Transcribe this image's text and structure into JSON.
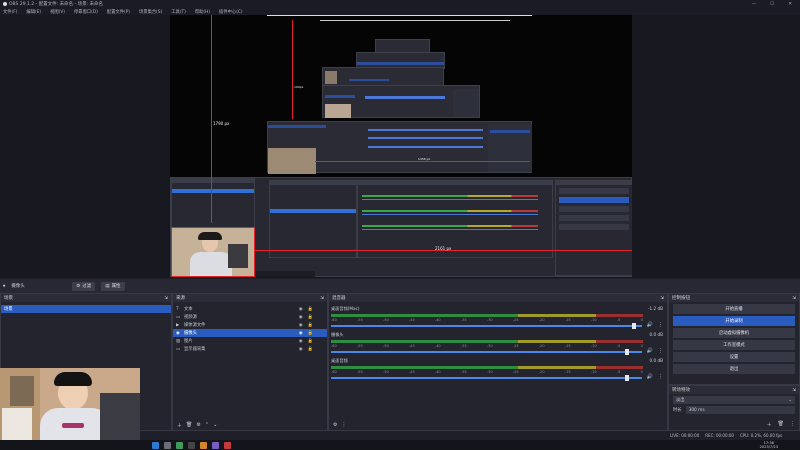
{
  "window": {
    "title": "OBS 29.1.2 - 配置文件: 未命名 - 场景: 未命名",
    "controls": [
      "—",
      "☐",
      "✕"
    ]
  },
  "menu": [
    "文件(F)",
    "编辑(E)",
    "视图(V)",
    "停靠窗口(D)",
    "配置文件(P)",
    "场景集合(S)",
    "工具(T)",
    "帮助(H)",
    "插件中心(C)"
  ],
  "preview": {
    "height_label": "1790 px",
    "width_label": "2161 px",
    "nested_h_label": "199px",
    "nested_w_label": "1456 px"
  },
  "scenebar": {
    "scene_name": "摄像头",
    "filter_btn": "过滤",
    "properties_btn": "属性"
  },
  "scenes": {
    "title": "场景",
    "items": [
      "场景"
    ],
    "selected": 0
  },
  "sources": {
    "title": "来源",
    "items": [
      "文本",
      "视频源",
      "媒体源文件",
      "摄像头",
      "图片",
      "显示器采集"
    ],
    "selected": 3
  },
  "mixer": {
    "title": "混音器",
    "channels": [
      {
        "name": "桌面音频(Mac)",
        "db": "-1.2 dB",
        "level": 0.98
      },
      {
        "name": "摄像头",
        "db": "0.0 dB",
        "level": 0.96
      },
      {
        "name": "桌面音频",
        "db": "0.0 dB",
        "level": 0.96
      }
    ],
    "ticks": [
      "-60",
      "-55",
      "-50",
      "-45",
      "-40",
      "-35",
      "-30",
      "-25",
      "-20",
      "-15",
      "-10",
      "-5",
      "0"
    ]
  },
  "controls": {
    "title": "控制按钮",
    "buttons": [
      "开始直播",
      "开始录制",
      "启动虚拟摄像机",
      "工作室模式",
      "设置",
      "退出"
    ],
    "active": 1
  },
  "transitions": {
    "title": "转场特效",
    "type": "淡出",
    "duration_label": "时长",
    "duration": "300 ms"
  },
  "status": {
    "live": "LIVE: 00:00:00",
    "rec": "REC: 00:00:00",
    "cpu": "CPU: 0.2%, 60.00 fps"
  },
  "taskbar": {
    "time": "17:36",
    "date": "2023/7/23"
  },
  "colors": {
    "accent": "#2a5cc0",
    "red_guide": "#e3232b",
    "bg": "#1e1f29"
  }
}
